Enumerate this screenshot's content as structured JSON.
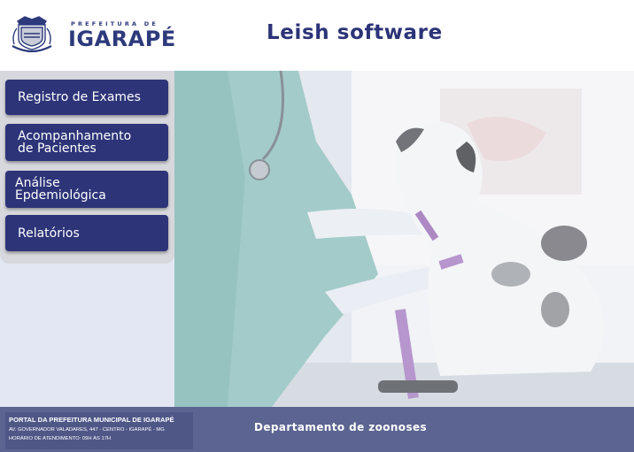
{
  "header": {
    "logo_small": "PREFEITURA DE",
    "logo_big": "IGARAPÉ",
    "app_title": "Leish software"
  },
  "menu": {
    "items": [
      {
        "label": "Registro de Exames"
      },
      {
        "label": "Acompanhamento\nde Pacientes"
      },
      {
        "label": "Análise\nEpdemiológica"
      },
      {
        "label": "Relatórios"
      }
    ]
  },
  "footer": {
    "portal_title": "PORTAL DA PREFEITURA MUNICIPAL DE IGARAPÉ",
    "address": "AV. GOVERNADOR VALADARES, 447 - CENTRO - IGARAPÉ - MG",
    "hours": "HORÁRIO DE ATENDIMENTO: 09H ÀS 17H",
    "department": "Departamento de zoonoses"
  },
  "colors": {
    "brand_navy": "#2d3478",
    "footer_bg": "#5c6491",
    "menu_bg": "#d7d8dd"
  }
}
